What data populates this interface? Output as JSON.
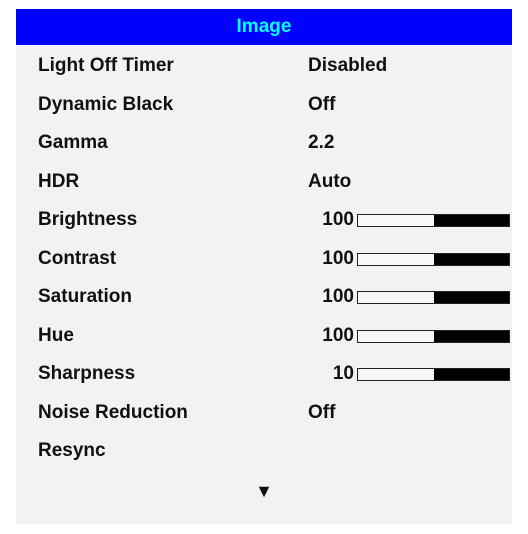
{
  "menu": {
    "title": "Image",
    "items": [
      {
        "label": "Light Off Timer",
        "value": "Disabled"
      },
      {
        "label": "Dynamic Black",
        "value": "Off"
      },
      {
        "label": "Gamma",
        "value": "2.2"
      },
      {
        "label": "HDR",
        "value": "Auto"
      },
      {
        "label": "Brightness",
        "value": "100",
        "level": 0.5
      },
      {
        "label": "Contrast",
        "value": "100",
        "level": 0.5
      },
      {
        "label": "Saturation",
        "value": "100",
        "level": 0.5
      },
      {
        "label": "Hue",
        "value": "100",
        "level": 0.5
      },
      {
        "label": "Sharpness",
        "value": "10",
        "level": 0.5
      },
      {
        "label": "Noise Reduction",
        "value": "Off"
      },
      {
        "label": "Resync"
      }
    ],
    "more_indicator": "▼"
  },
  "colors": {
    "header_bg": "#0000ff",
    "header_text": "#00ffff",
    "panel_bg": "#f2f2f2"
  }
}
